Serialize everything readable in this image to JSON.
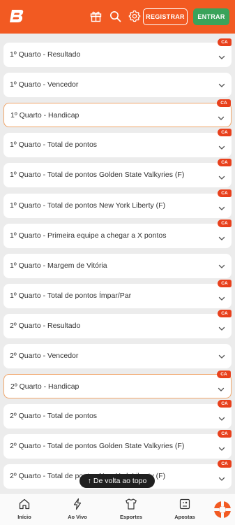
{
  "header": {
    "logo_text": "B",
    "register_label": "REGISTRAR",
    "login_label": "ENTRAR",
    "colors": {
      "brand": "#f25a22",
      "login": "#3aa35a",
      "badge": "#e8401c"
    },
    "icons": [
      "gift-icon",
      "search-icon",
      "settings-icon"
    ]
  },
  "markets": [
    {
      "label": "1º Quarto - Resultado",
      "badge": "CA",
      "highlight": false
    },
    {
      "label": "1º Quarto - Vencedor",
      "badge": "",
      "highlight": false
    },
    {
      "label": "1º Quarto - Handicap",
      "badge": "CA",
      "highlight": true
    },
    {
      "label": "1º Quarto - Total de pontos",
      "badge": "CA",
      "highlight": false
    },
    {
      "label": "1º Quarto - Total de pontos Golden State Valkyries (F)",
      "badge": "CA",
      "highlight": false
    },
    {
      "label": "1º Quarto - Total de pontos New York Liberty (F)",
      "badge": "CA",
      "highlight": false
    },
    {
      "label": "1º Quarto - Primeira equipe a chegar a X pontos",
      "badge": "CA",
      "highlight": false
    },
    {
      "label": "1º Quarto - Margem de Vitória",
      "badge": "",
      "highlight": false
    },
    {
      "label": "1º Quarto - Total de pontos Ímpar/Par",
      "badge": "CA",
      "highlight": false
    },
    {
      "label": "2º Quarto - Resultado",
      "badge": "CA",
      "highlight": false
    },
    {
      "label": "2º Quarto - Vencedor",
      "badge": "",
      "highlight": false
    },
    {
      "label": "2º Quarto - Handicap",
      "badge": "CA",
      "highlight": true
    },
    {
      "label": "2º Quarto - Total de pontos",
      "badge": "CA",
      "highlight": false
    },
    {
      "label": "2º Quarto - Total de pontos Golden State Valkyries (F)",
      "badge": "CA",
      "highlight": false
    },
    {
      "label": "2º Quarto - Total de pontos New York Liberty (F)",
      "badge": "CA",
      "highlight": false
    }
  ],
  "back_to_top": {
    "label": "De volta ao topo",
    "icon": "arrow-up-icon"
  },
  "bottom_nav": [
    {
      "label": "Início",
      "icon": "home-icon"
    },
    {
      "label": "Ao Vivo",
      "icon": "live-bolt-icon"
    },
    {
      "label": "Esportes",
      "icon": "jersey-icon"
    },
    {
      "label": "Apostas",
      "icon": "betslip-icon"
    }
  ],
  "support": {
    "icon": "support-lifebuoy-icon"
  }
}
